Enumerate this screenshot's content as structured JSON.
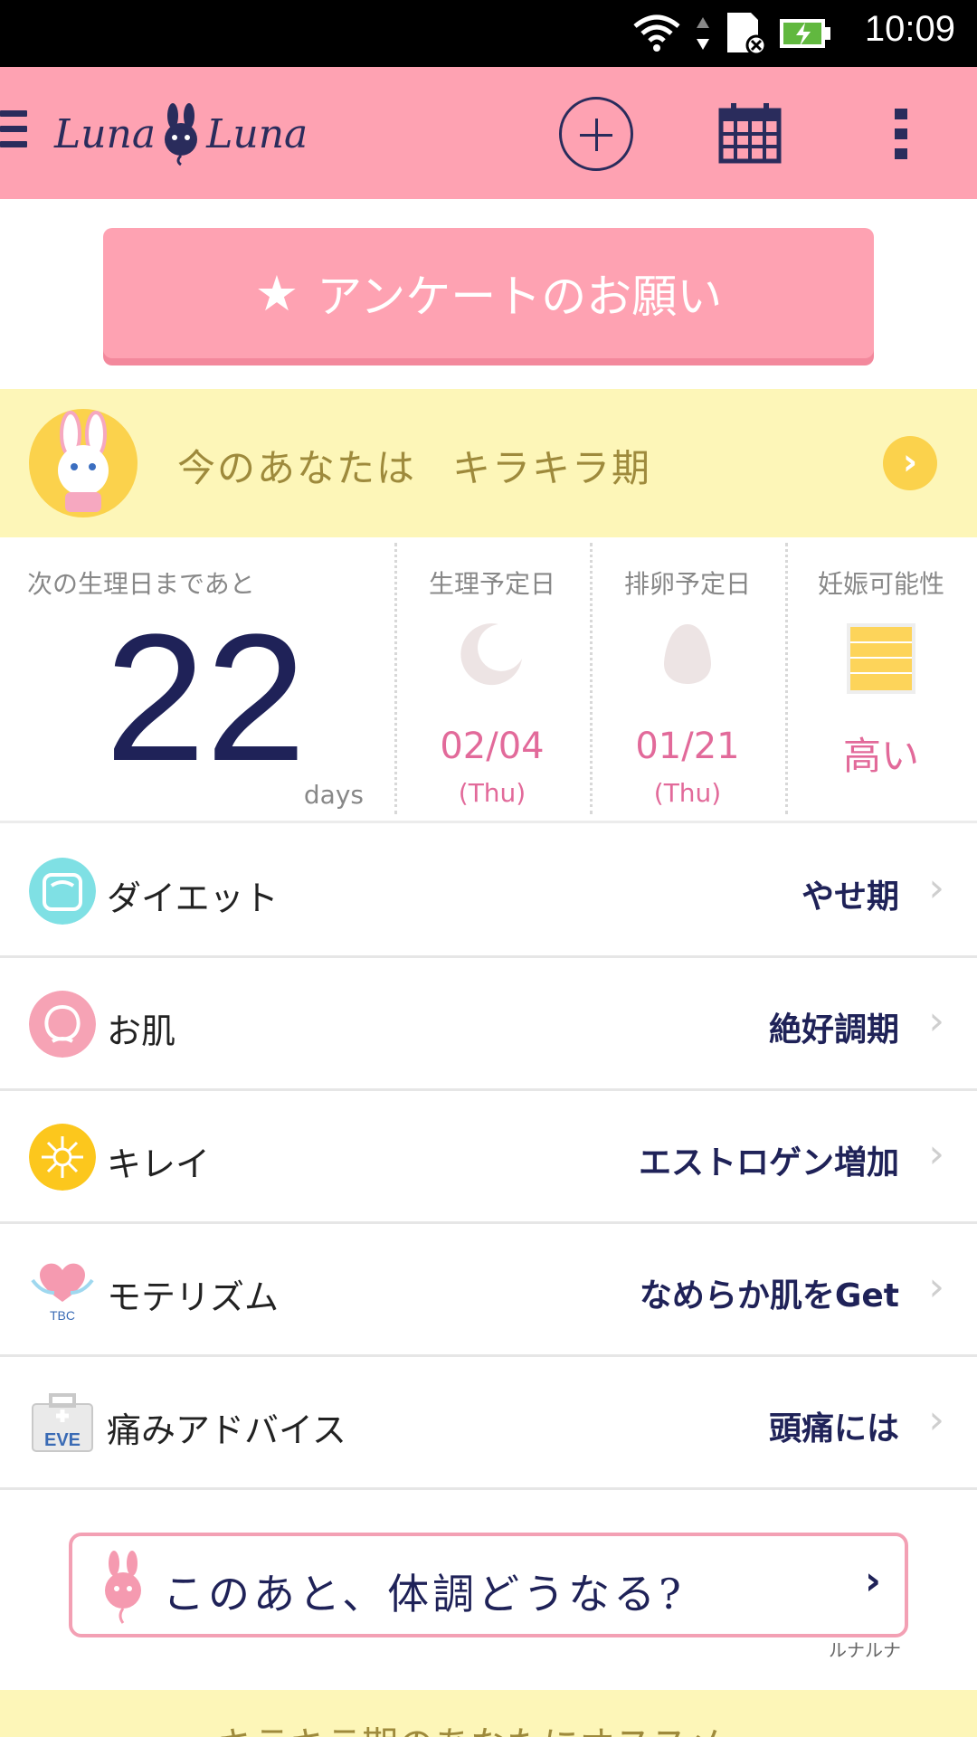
{
  "status_bar": {
    "time": "10:09"
  },
  "app_bar": {
    "logo_text_left": "Luna",
    "logo_text_right": "Luna"
  },
  "survey": {
    "label": "アンケートのお願い"
  },
  "phase": {
    "prefix": "今のあなたは",
    "name": "キラキラ期"
  },
  "cycle": {
    "countdown_label": "次の生理日まであと",
    "countdown_value": "22",
    "countdown_unit": "days",
    "period": {
      "label": "生理予定日",
      "date": "02/04",
      "day": "(Thu)"
    },
    "ovulation": {
      "label": "排卵予定日",
      "date": "01/21",
      "day": "(Thu)"
    },
    "fertility": {
      "label": "妊娠可能性",
      "value": "高い"
    }
  },
  "list": [
    {
      "label": "ダイエット",
      "value": "やせ期",
      "icon": "scale-icon"
    },
    {
      "label": "お肌",
      "value": "絶好調期",
      "icon": "peach-icon"
    },
    {
      "label": "キレイ",
      "value": "エストロゲン増加",
      "icon": "sparkle-icon"
    },
    {
      "label": "モテリズム",
      "value": "なめらか肌をGet",
      "icon": "tbc-heart-icon",
      "icon_text": "TBC"
    },
    {
      "label": "痛みアドバイス",
      "value": "頭痛には",
      "icon": "eve-box-icon",
      "icon_text": "EVE"
    }
  ],
  "forecast": {
    "label": "このあと、体調どうなる?",
    "sub": "ルナルナ"
  },
  "bottom_banner": {
    "label": "キラキラ期のあなたにオススメ"
  },
  "colors": {
    "pink": "#fea2b2",
    "navy": "#1f2258",
    "yellow_bg": "#fdf6b8",
    "accent_pink": "#e26a9a"
  }
}
